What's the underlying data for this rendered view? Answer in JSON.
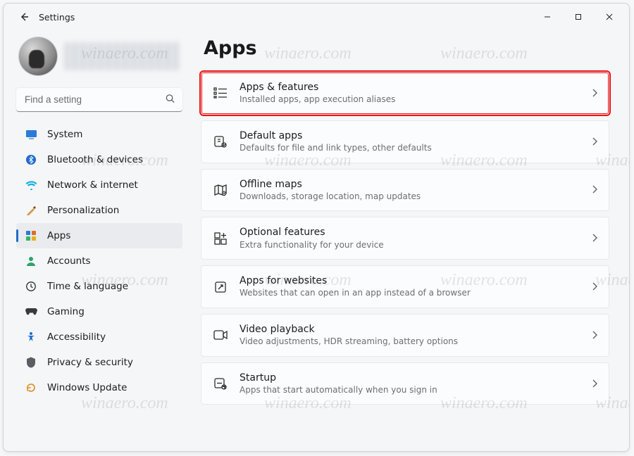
{
  "window": {
    "title": "Settings"
  },
  "search": {
    "placeholder": "Find a setting"
  },
  "sidebar": {
    "items": [
      {
        "label": "System",
        "icon": "system"
      },
      {
        "label": "Bluetooth & devices",
        "icon": "bluetooth"
      },
      {
        "label": "Network & internet",
        "icon": "wifi"
      },
      {
        "label": "Personalization",
        "icon": "brush"
      },
      {
        "label": "Apps",
        "icon": "apps",
        "selected": true
      },
      {
        "label": "Accounts",
        "icon": "person"
      },
      {
        "label": "Time & language",
        "icon": "clock"
      },
      {
        "label": "Gaming",
        "icon": "gamepad"
      },
      {
        "label": "Accessibility",
        "icon": "accessibility"
      },
      {
        "label": "Privacy & security",
        "icon": "shield"
      },
      {
        "label": "Windows Update",
        "icon": "update"
      }
    ]
  },
  "page": {
    "title": "Apps",
    "cards": [
      {
        "title": "Apps & features",
        "sub": "Installed apps, app execution aliases",
        "icon": "list",
        "highlight": true
      },
      {
        "title": "Default apps",
        "sub": "Defaults for file and link types, other defaults",
        "icon": "defaults"
      },
      {
        "title": "Offline maps",
        "sub": "Downloads, storage location, map updates",
        "icon": "map"
      },
      {
        "title": "Optional features",
        "sub": "Extra functionality for your device",
        "icon": "grid"
      },
      {
        "title": "Apps for websites",
        "sub": "Websites that can open in an app instead of a browser",
        "icon": "weblink"
      },
      {
        "title": "Video playback",
        "sub": "Video adjustments, HDR streaming, battery options",
        "icon": "video"
      },
      {
        "title": "Startup",
        "sub": "Apps that start automatically when you sign in",
        "icon": "startup"
      }
    ]
  },
  "watermark": "winaero.com"
}
